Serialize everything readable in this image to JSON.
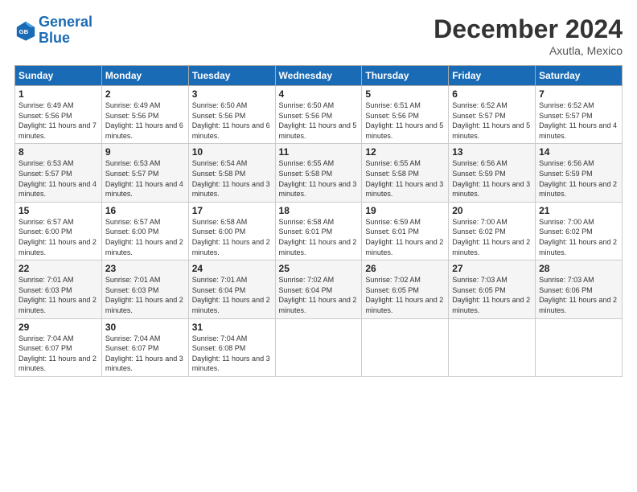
{
  "logo": {
    "line1": "General",
    "line2": "Blue"
  },
  "title": "December 2024",
  "location": "Axutla, Mexico",
  "days_of_week": [
    "Sunday",
    "Monday",
    "Tuesday",
    "Wednesday",
    "Thursday",
    "Friday",
    "Saturday"
  ],
  "weeks": [
    [
      {
        "num": "1",
        "sunrise": "6:49 AM",
        "sunset": "5:56 PM",
        "daylight": "11 hours and 7 minutes."
      },
      {
        "num": "2",
        "sunrise": "6:49 AM",
        "sunset": "5:56 PM",
        "daylight": "11 hours and 6 minutes."
      },
      {
        "num": "3",
        "sunrise": "6:50 AM",
        "sunset": "5:56 PM",
        "daylight": "11 hours and 6 minutes."
      },
      {
        "num": "4",
        "sunrise": "6:50 AM",
        "sunset": "5:56 PM",
        "daylight": "11 hours and 5 minutes."
      },
      {
        "num": "5",
        "sunrise": "6:51 AM",
        "sunset": "5:56 PM",
        "daylight": "11 hours and 5 minutes."
      },
      {
        "num": "6",
        "sunrise": "6:52 AM",
        "sunset": "5:57 PM",
        "daylight": "11 hours and 5 minutes."
      },
      {
        "num": "7",
        "sunrise": "6:52 AM",
        "sunset": "5:57 PM",
        "daylight": "11 hours and 4 minutes."
      }
    ],
    [
      {
        "num": "8",
        "sunrise": "6:53 AM",
        "sunset": "5:57 PM",
        "daylight": "11 hours and 4 minutes."
      },
      {
        "num": "9",
        "sunrise": "6:53 AM",
        "sunset": "5:57 PM",
        "daylight": "11 hours and 4 minutes."
      },
      {
        "num": "10",
        "sunrise": "6:54 AM",
        "sunset": "5:58 PM",
        "daylight": "11 hours and 3 minutes."
      },
      {
        "num": "11",
        "sunrise": "6:55 AM",
        "sunset": "5:58 PM",
        "daylight": "11 hours and 3 minutes."
      },
      {
        "num": "12",
        "sunrise": "6:55 AM",
        "sunset": "5:58 PM",
        "daylight": "11 hours and 3 minutes."
      },
      {
        "num": "13",
        "sunrise": "6:56 AM",
        "sunset": "5:59 PM",
        "daylight": "11 hours and 3 minutes."
      },
      {
        "num": "14",
        "sunrise": "6:56 AM",
        "sunset": "5:59 PM",
        "daylight": "11 hours and 2 minutes."
      }
    ],
    [
      {
        "num": "15",
        "sunrise": "6:57 AM",
        "sunset": "6:00 PM",
        "daylight": "11 hours and 2 minutes."
      },
      {
        "num": "16",
        "sunrise": "6:57 AM",
        "sunset": "6:00 PM",
        "daylight": "11 hours and 2 minutes."
      },
      {
        "num": "17",
        "sunrise": "6:58 AM",
        "sunset": "6:00 PM",
        "daylight": "11 hours and 2 minutes."
      },
      {
        "num": "18",
        "sunrise": "6:58 AM",
        "sunset": "6:01 PM",
        "daylight": "11 hours and 2 minutes."
      },
      {
        "num": "19",
        "sunrise": "6:59 AM",
        "sunset": "6:01 PM",
        "daylight": "11 hours and 2 minutes."
      },
      {
        "num": "20",
        "sunrise": "7:00 AM",
        "sunset": "6:02 PM",
        "daylight": "11 hours and 2 minutes."
      },
      {
        "num": "21",
        "sunrise": "7:00 AM",
        "sunset": "6:02 PM",
        "daylight": "11 hours and 2 minutes."
      }
    ],
    [
      {
        "num": "22",
        "sunrise": "7:01 AM",
        "sunset": "6:03 PM",
        "daylight": "11 hours and 2 minutes."
      },
      {
        "num": "23",
        "sunrise": "7:01 AM",
        "sunset": "6:03 PM",
        "daylight": "11 hours and 2 minutes."
      },
      {
        "num": "24",
        "sunrise": "7:01 AM",
        "sunset": "6:04 PM",
        "daylight": "11 hours and 2 minutes."
      },
      {
        "num": "25",
        "sunrise": "7:02 AM",
        "sunset": "6:04 PM",
        "daylight": "11 hours and 2 minutes."
      },
      {
        "num": "26",
        "sunrise": "7:02 AM",
        "sunset": "6:05 PM",
        "daylight": "11 hours and 2 minutes."
      },
      {
        "num": "27",
        "sunrise": "7:03 AM",
        "sunset": "6:05 PM",
        "daylight": "11 hours and 2 minutes."
      },
      {
        "num": "28",
        "sunrise": "7:03 AM",
        "sunset": "6:06 PM",
        "daylight": "11 hours and 2 minutes."
      }
    ],
    [
      {
        "num": "29",
        "sunrise": "7:04 AM",
        "sunset": "6:07 PM",
        "daylight": "11 hours and 2 minutes."
      },
      {
        "num": "30",
        "sunrise": "7:04 AM",
        "sunset": "6:07 PM",
        "daylight": "11 hours and 3 minutes."
      },
      {
        "num": "31",
        "sunrise": "7:04 AM",
        "sunset": "6:08 PM",
        "daylight": "11 hours and 3 minutes."
      },
      null,
      null,
      null,
      null
    ]
  ]
}
